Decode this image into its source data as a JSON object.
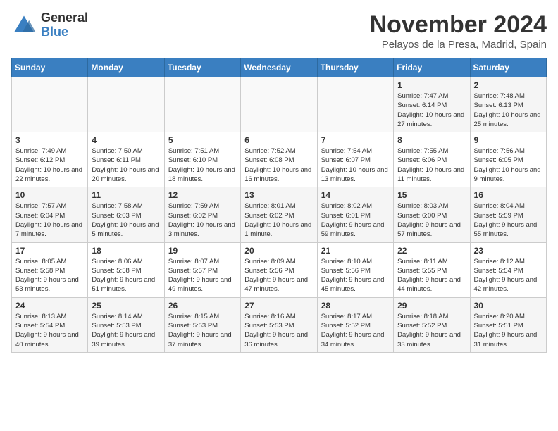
{
  "header": {
    "logo": {
      "general": "General",
      "blue": "Blue"
    },
    "title": "November 2024",
    "location": "Pelayos de la Presa, Madrid, Spain"
  },
  "calendar": {
    "weekdays": [
      "Sunday",
      "Monday",
      "Tuesday",
      "Wednesday",
      "Thursday",
      "Friday",
      "Saturday"
    ],
    "weeks": [
      [
        {
          "day": "",
          "info": ""
        },
        {
          "day": "",
          "info": ""
        },
        {
          "day": "",
          "info": ""
        },
        {
          "day": "",
          "info": ""
        },
        {
          "day": "",
          "info": ""
        },
        {
          "day": "1",
          "info": "Sunrise: 7:47 AM\nSunset: 6:14 PM\nDaylight: 10 hours and 27 minutes."
        },
        {
          "day": "2",
          "info": "Sunrise: 7:48 AM\nSunset: 6:13 PM\nDaylight: 10 hours and 25 minutes."
        }
      ],
      [
        {
          "day": "3",
          "info": "Sunrise: 7:49 AM\nSunset: 6:12 PM\nDaylight: 10 hours and 22 minutes."
        },
        {
          "day": "4",
          "info": "Sunrise: 7:50 AM\nSunset: 6:11 PM\nDaylight: 10 hours and 20 minutes."
        },
        {
          "day": "5",
          "info": "Sunrise: 7:51 AM\nSunset: 6:10 PM\nDaylight: 10 hours and 18 minutes."
        },
        {
          "day": "6",
          "info": "Sunrise: 7:52 AM\nSunset: 6:08 PM\nDaylight: 10 hours and 16 minutes."
        },
        {
          "day": "7",
          "info": "Sunrise: 7:54 AM\nSunset: 6:07 PM\nDaylight: 10 hours and 13 minutes."
        },
        {
          "day": "8",
          "info": "Sunrise: 7:55 AM\nSunset: 6:06 PM\nDaylight: 10 hours and 11 minutes."
        },
        {
          "day": "9",
          "info": "Sunrise: 7:56 AM\nSunset: 6:05 PM\nDaylight: 10 hours and 9 minutes."
        }
      ],
      [
        {
          "day": "10",
          "info": "Sunrise: 7:57 AM\nSunset: 6:04 PM\nDaylight: 10 hours and 7 minutes."
        },
        {
          "day": "11",
          "info": "Sunrise: 7:58 AM\nSunset: 6:03 PM\nDaylight: 10 hours and 5 minutes."
        },
        {
          "day": "12",
          "info": "Sunrise: 7:59 AM\nSunset: 6:02 PM\nDaylight: 10 hours and 3 minutes."
        },
        {
          "day": "13",
          "info": "Sunrise: 8:01 AM\nSunset: 6:02 PM\nDaylight: 10 hours and 1 minute."
        },
        {
          "day": "14",
          "info": "Sunrise: 8:02 AM\nSunset: 6:01 PM\nDaylight: 9 hours and 59 minutes."
        },
        {
          "day": "15",
          "info": "Sunrise: 8:03 AM\nSunset: 6:00 PM\nDaylight: 9 hours and 57 minutes."
        },
        {
          "day": "16",
          "info": "Sunrise: 8:04 AM\nSunset: 5:59 PM\nDaylight: 9 hours and 55 minutes."
        }
      ],
      [
        {
          "day": "17",
          "info": "Sunrise: 8:05 AM\nSunset: 5:58 PM\nDaylight: 9 hours and 53 minutes."
        },
        {
          "day": "18",
          "info": "Sunrise: 8:06 AM\nSunset: 5:58 PM\nDaylight: 9 hours and 51 minutes."
        },
        {
          "day": "19",
          "info": "Sunrise: 8:07 AM\nSunset: 5:57 PM\nDaylight: 9 hours and 49 minutes."
        },
        {
          "day": "20",
          "info": "Sunrise: 8:09 AM\nSunset: 5:56 PM\nDaylight: 9 hours and 47 minutes."
        },
        {
          "day": "21",
          "info": "Sunrise: 8:10 AM\nSunset: 5:56 PM\nDaylight: 9 hours and 45 minutes."
        },
        {
          "day": "22",
          "info": "Sunrise: 8:11 AM\nSunset: 5:55 PM\nDaylight: 9 hours and 44 minutes."
        },
        {
          "day": "23",
          "info": "Sunrise: 8:12 AM\nSunset: 5:54 PM\nDaylight: 9 hours and 42 minutes."
        }
      ],
      [
        {
          "day": "24",
          "info": "Sunrise: 8:13 AM\nSunset: 5:54 PM\nDaylight: 9 hours and 40 minutes."
        },
        {
          "day": "25",
          "info": "Sunrise: 8:14 AM\nSunset: 5:53 PM\nDaylight: 9 hours and 39 minutes."
        },
        {
          "day": "26",
          "info": "Sunrise: 8:15 AM\nSunset: 5:53 PM\nDaylight: 9 hours and 37 minutes."
        },
        {
          "day": "27",
          "info": "Sunrise: 8:16 AM\nSunset: 5:53 PM\nDaylight: 9 hours and 36 minutes."
        },
        {
          "day": "28",
          "info": "Sunrise: 8:17 AM\nSunset: 5:52 PM\nDaylight: 9 hours and 34 minutes."
        },
        {
          "day": "29",
          "info": "Sunrise: 8:18 AM\nSunset: 5:52 PM\nDaylight: 9 hours and 33 minutes."
        },
        {
          "day": "30",
          "info": "Sunrise: 8:20 AM\nSunset: 5:51 PM\nDaylight: 9 hours and 31 minutes."
        }
      ]
    ]
  }
}
